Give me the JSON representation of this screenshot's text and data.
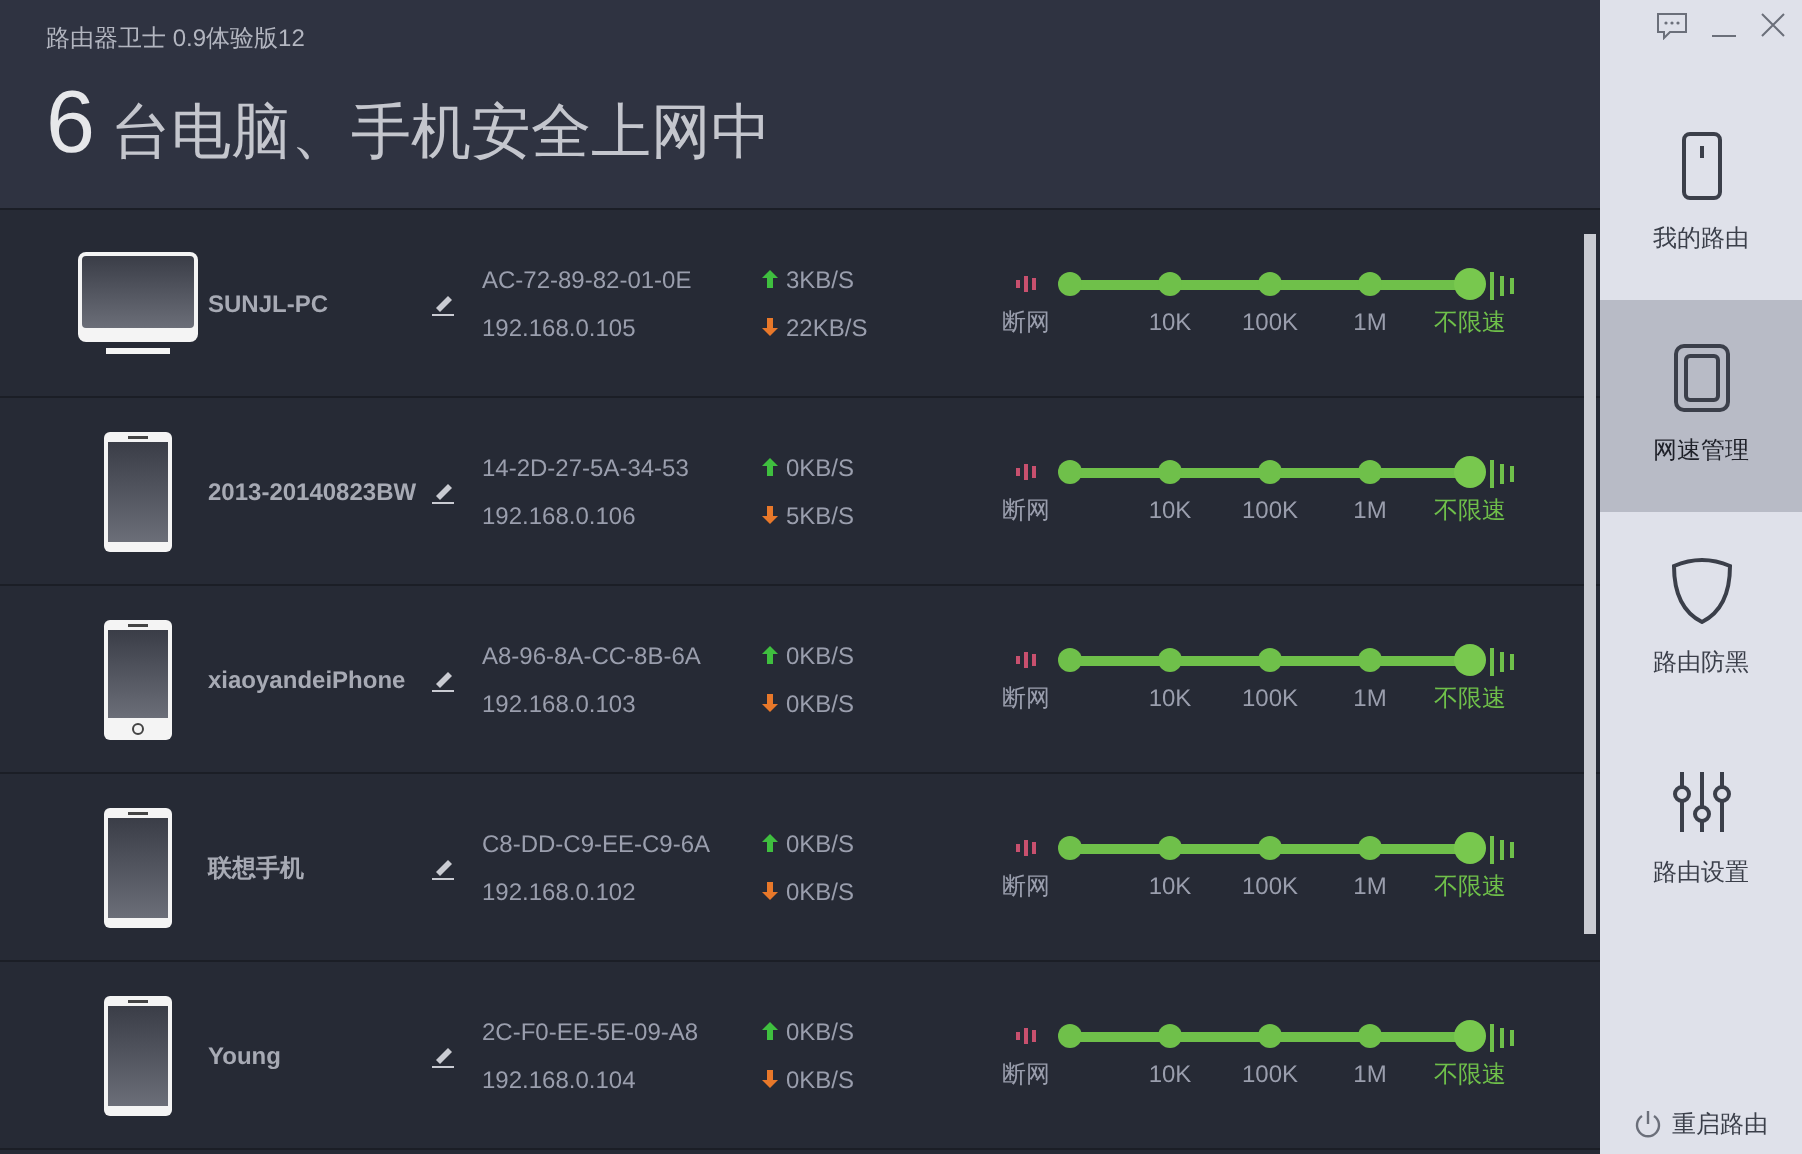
{
  "window": {
    "title": "路由器卫士 0.9体验版12"
  },
  "headline": {
    "count": "6",
    "text": "台电脑、手机安全上网中"
  },
  "devices": [
    {
      "kind": "pc",
      "name": "SUNJL-PC",
      "mac": "AC-72-89-82-01-0E",
      "ip": "192.168.0.105",
      "up": "3KB/S",
      "down": "22KB/S",
      "level": 1,
      "speed_labels": [
        "断网",
        "10K",
        "100K",
        "1M",
        "不限速"
      ]
    },
    {
      "kind": "phone",
      "name": "2013-20140823BW",
      "mac": "14-2D-27-5A-34-53",
      "ip": "192.168.0.106",
      "up": "0KB/S",
      "down": "5KB/S",
      "level": 1,
      "speed_labels": [
        "断网",
        "10K",
        "100K",
        "1M",
        "不限速"
      ]
    },
    {
      "kind": "phone-button",
      "name": "xiaoyandeiPhone",
      "mac": "A8-96-8A-CC-8B-6A",
      "ip": "192.168.0.103",
      "up": "0KB/S",
      "down": "0KB/S",
      "level": 1,
      "speed_labels": [
        "断网",
        "10K",
        "100K",
        "1M",
        "不限速"
      ]
    },
    {
      "kind": "phone",
      "name": "联想手机",
      "mac": "C8-DD-C9-EE-C9-6A",
      "ip": "192.168.0.102",
      "up": "0KB/S",
      "down": "0KB/S",
      "level": 1,
      "speed_labels": [
        "断网",
        "10K",
        "100K",
        "1M",
        "不限速"
      ]
    },
    {
      "kind": "phone",
      "name": "Young",
      "mac": "2C-F0-EE-5E-09-A8",
      "ip": "192.168.0.104",
      "up": "0KB/S",
      "down": "0KB/S",
      "level": 1,
      "speed_labels": [
        "断网",
        "10K",
        "100K",
        "1M",
        "不限速"
      ]
    }
  ],
  "nav": [
    {
      "kind": "router",
      "label": "我的路由",
      "selected": false
    },
    {
      "kind": "speed",
      "label": "网速管理",
      "selected": true
    },
    {
      "kind": "shield",
      "label": "路由防黑",
      "selected": false
    },
    {
      "kind": "sliders",
      "label": "路由设置",
      "selected": false
    }
  ],
  "restart": {
    "label": "重启路由"
  }
}
